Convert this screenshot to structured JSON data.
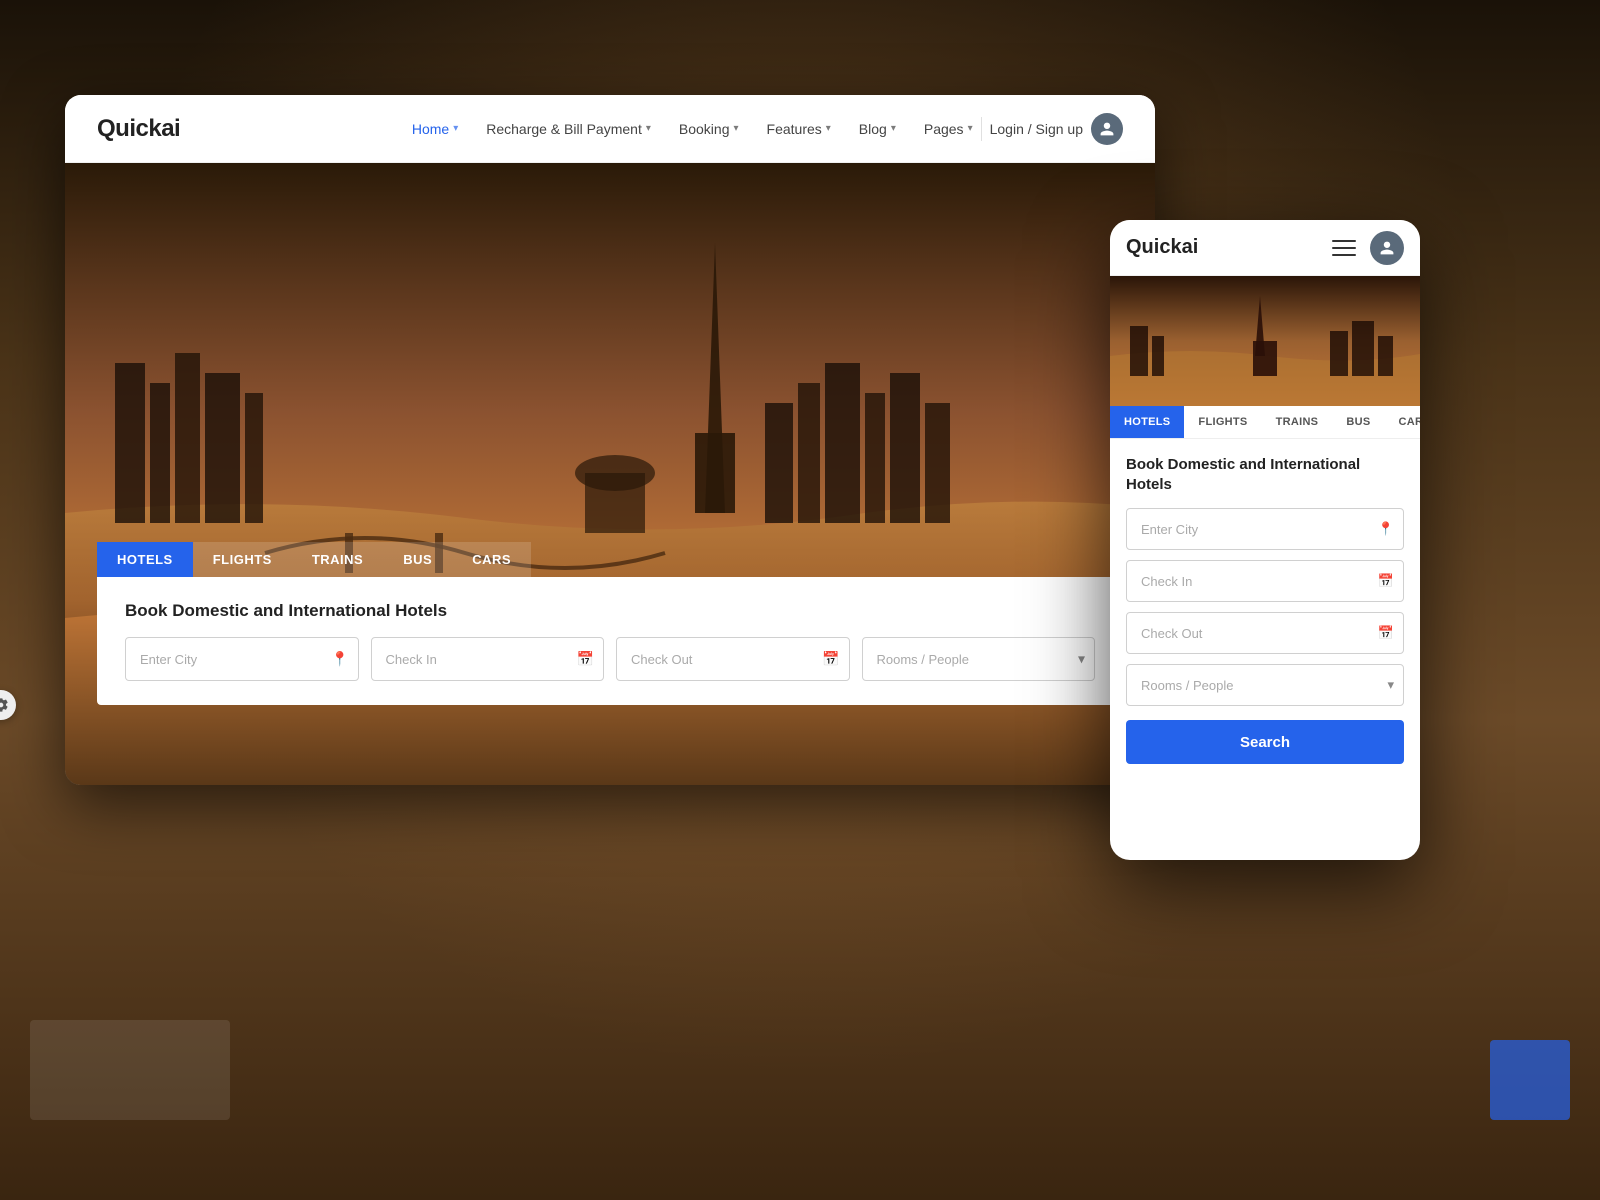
{
  "background": {
    "color": "#3a2a20"
  },
  "desktop": {
    "logo": "Quickai",
    "nav": {
      "links": [
        {
          "label": "Home",
          "active": true,
          "has_dropdown": true
        },
        {
          "label": "Recharge & Bill Payment",
          "active": false,
          "has_dropdown": true
        },
        {
          "label": "Booking",
          "active": false,
          "has_dropdown": true
        },
        {
          "label": "Features",
          "active": false,
          "has_dropdown": true
        },
        {
          "label": "Blog",
          "active": false,
          "has_dropdown": true
        },
        {
          "label": "Pages",
          "active": false,
          "has_dropdown": true
        }
      ],
      "login_label": "Login / Sign up"
    },
    "tabs": [
      {
        "label": "HOTELS",
        "active": true
      },
      {
        "label": "FLIGHTS",
        "active": false
      },
      {
        "label": "TRAINS",
        "active": false
      },
      {
        "label": "BUS",
        "active": false
      },
      {
        "label": "CARS",
        "active": false
      }
    ],
    "search": {
      "title": "Book Domestic and International Hotels",
      "city_placeholder": "Enter City",
      "checkin_placeholder": "Check In",
      "checkout_placeholder": "Check Out",
      "rooms_placeholder": "Rooms / People"
    }
  },
  "mobile": {
    "logo": "Quickai",
    "tabs": [
      {
        "label": "HOTELS",
        "active": true
      },
      {
        "label": "FLIGHTS",
        "active": false
      },
      {
        "label": "TRAINS",
        "active": false
      },
      {
        "label": "BUS",
        "active": false
      },
      {
        "label": "CARS",
        "active": false
      }
    ],
    "search": {
      "title": "Book Domestic and International Hotels",
      "city_placeholder": "Enter City",
      "checkin_placeholder": "Check In",
      "checkout_placeholder": "Check Out",
      "rooms_placeholder": "Rooms / People",
      "search_button": "Search"
    }
  }
}
